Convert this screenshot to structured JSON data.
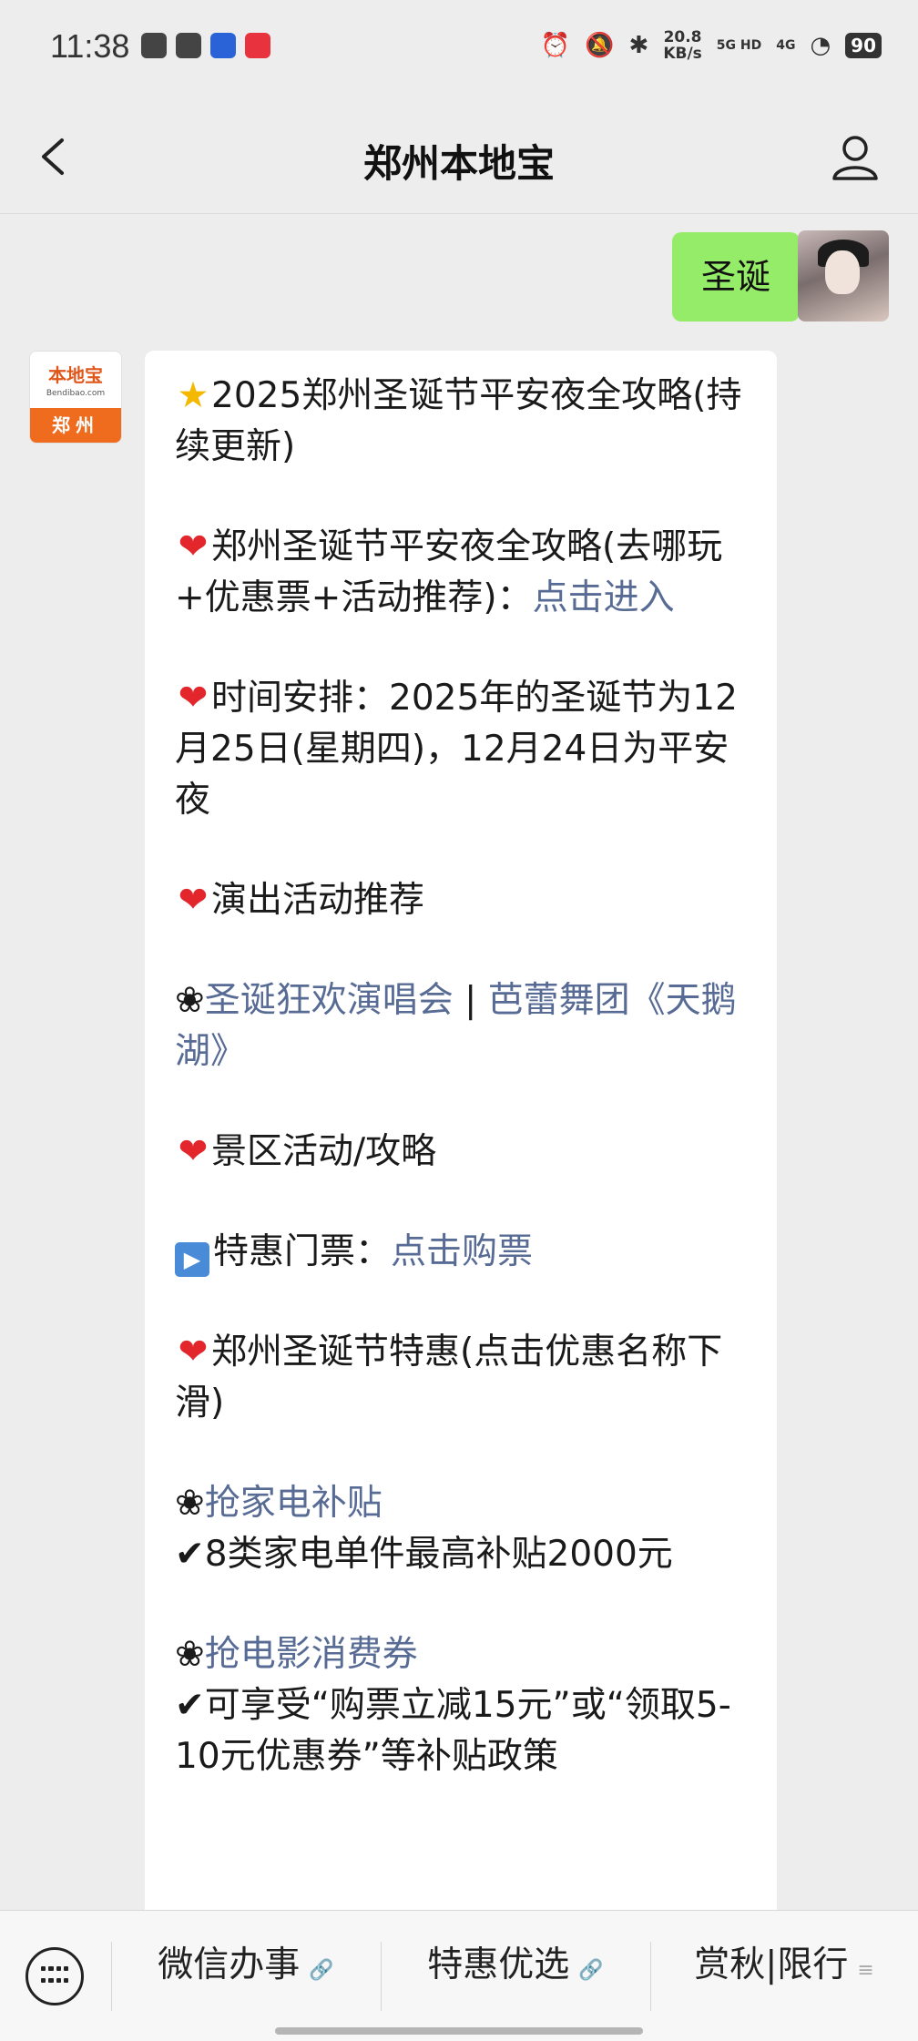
{
  "status_bar": {
    "time": "11:38",
    "speed": "20.8",
    "speed_unit": "KB/s",
    "net1": "5G HD",
    "net2": "4G",
    "battery": "90"
  },
  "header": {
    "title": "郑州本地宝"
  },
  "chat": {
    "sent_message": "圣诞",
    "bot_avatar": {
      "logo": "本地宝",
      "url": "Bendibao.com",
      "city": "郑州"
    },
    "reply": {
      "title": "2025郑州圣诞节平安夜全攻略(持续更新)",
      "guide_text": "郑州圣诞节平安夜全攻略(去哪玩+优惠票+活动推荐)：",
      "guide_link": "点击进入",
      "time_text": "时间安排：2025年的圣诞节为12月25日(星期四)，12月24日为平安夜",
      "shows_heading": "演出活动推荐",
      "show_link1": "圣诞狂欢演唱会",
      "show_sep": " | ",
      "show_link2": "芭蕾舞团《天鹅湖》",
      "scenic_heading": "景区活动/攻略",
      "ticket_text": "特惠门票：",
      "ticket_link": "点击购票",
      "deals_heading": "郑州圣诞节特惠(点击优惠名称下滑)",
      "deal1_link": "抢家电补贴",
      "deal1_text": "8类家电单件最高补贴2000元",
      "deal2_link": "抢电影消费券",
      "deal2_text": "可享受“购票立减15元”或“领取5-10元优惠券”等补贴政策"
    }
  },
  "bottom_menu": {
    "item1": "微信办事",
    "item2": "特惠优选",
    "item3": "赏秋|限行"
  }
}
